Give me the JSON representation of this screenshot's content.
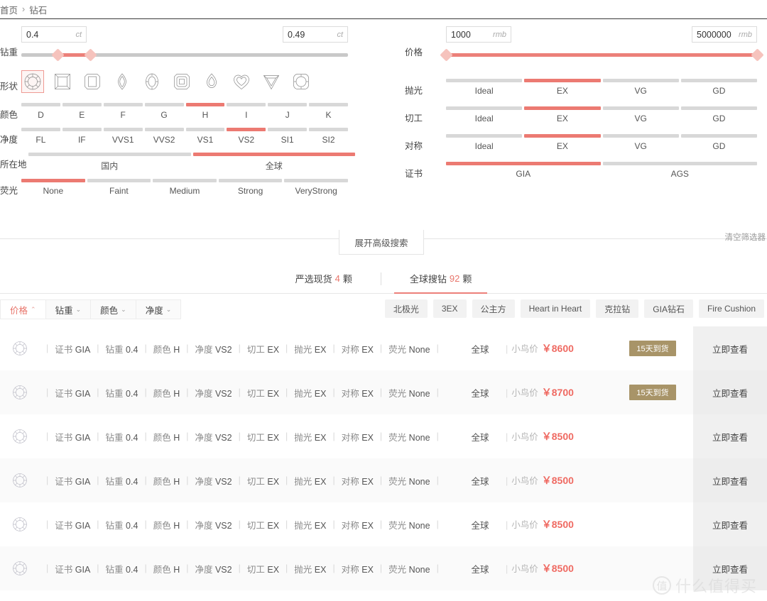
{
  "breadcrumb": {
    "home": "首页",
    "sep": "›",
    "current": "钻石"
  },
  "filters": {
    "carat": {
      "label": "钻重",
      "min_value": "0.4",
      "max_value": "0.49",
      "unit": "ct",
      "min_pct": 11,
      "max_pct": 21
    },
    "price": {
      "label": "价格",
      "min_value": "1000",
      "max_value": "5000000",
      "unit": "rmb",
      "min_pct": 0,
      "max_pct": 100
    },
    "shape": {
      "label": "形状",
      "items": [
        {
          "name": "round",
          "selected": true
        },
        {
          "name": "princess",
          "selected": false
        },
        {
          "name": "emerald",
          "selected": false
        },
        {
          "name": "marquise",
          "selected": false
        },
        {
          "name": "oval",
          "selected": false
        },
        {
          "name": "radiant",
          "selected": false
        },
        {
          "name": "pear",
          "selected": false
        },
        {
          "name": "heart",
          "selected": false
        },
        {
          "name": "trillion",
          "selected": false
        },
        {
          "name": "cushion",
          "selected": false
        }
      ]
    },
    "color": {
      "label": "颜色",
      "options": [
        "D",
        "E",
        "F",
        "G",
        "H",
        "I",
        "J",
        "K"
      ],
      "selected_index": 4
    },
    "clarity": {
      "label": "净度",
      "options": [
        "FL",
        "IF",
        "VVS1",
        "VVS2",
        "VS1",
        "VS2",
        "SI1",
        "SI2"
      ],
      "selected_index": 5
    },
    "location": {
      "label": "所在地",
      "options": [
        "国内",
        "全球"
      ],
      "selected_index": 1
    },
    "fluorescence": {
      "label": "荧光",
      "options": [
        "None",
        "Faint",
        "Medium",
        "Strong",
        "VeryStrong"
      ],
      "selected_index": 0
    },
    "polish": {
      "label": "抛光",
      "options": [
        "Ideal",
        "EX",
        "VG",
        "GD"
      ],
      "selected_index": 1
    },
    "cut": {
      "label": "切工",
      "options": [
        "Ideal",
        "EX",
        "VG",
        "GD"
      ],
      "selected_index": 1
    },
    "symmetry": {
      "label": "对称",
      "options": [
        "Ideal",
        "EX",
        "VG",
        "GD"
      ],
      "selected_index": 1
    },
    "cert": {
      "label": "证书",
      "options": [
        "GIA",
        "AGS"
      ],
      "selected_index": 0
    },
    "advanced_button": "展开高级搜索",
    "clear_link": "清空筛选器"
  },
  "tabs": [
    {
      "label_before": "严选现货",
      "count": "4",
      "label_after": "颗",
      "active": false
    },
    {
      "label_before": "全球搜钻",
      "count": "92",
      "label_after": "颗",
      "active": true
    }
  ],
  "sorts": [
    {
      "label": "价格",
      "caret": "⌃",
      "active": true
    },
    {
      "label": "钻重",
      "caret": "⌄",
      "active": false
    },
    {
      "label": "颜色",
      "caret": "⌄",
      "active": false
    },
    {
      "label": "净度",
      "caret": "⌄",
      "active": false
    }
  ],
  "tags": [
    "北极光",
    "3EX",
    "公主方",
    "Heart in Heart",
    "克拉钻",
    "GIA钻石",
    "Fire Cushion"
  ],
  "results": {
    "spec_keys": {
      "cert": "证书",
      "carat": "钻重",
      "color": "颜色",
      "clarity": "净度",
      "cut": "切工",
      "polish": "抛光",
      "symmetry": "对称",
      "fluorescence": "荧光"
    },
    "price_label": "小鸟价",
    "currency": "￥",
    "view_button": "立即查看",
    "rows": [
      {
        "cert": "GIA",
        "carat": "0.4",
        "color": "H",
        "clarity": "VS2",
        "cut": "EX",
        "polish": "EX",
        "symmetry": "EX",
        "fluorescence": "None",
        "origin": "全球",
        "price": "8600",
        "badge": "15天到货"
      },
      {
        "cert": "GIA",
        "carat": "0.4",
        "color": "H",
        "clarity": "VS2",
        "cut": "EX",
        "polish": "EX",
        "symmetry": "EX",
        "fluorescence": "None",
        "origin": "全球",
        "price": "8700",
        "badge": "15天到货"
      },
      {
        "cert": "GIA",
        "carat": "0.4",
        "color": "H",
        "clarity": "VS2",
        "cut": "EX",
        "polish": "EX",
        "symmetry": "EX",
        "fluorescence": "None",
        "origin": "全球",
        "price": "8500",
        "badge": ""
      },
      {
        "cert": "GIA",
        "carat": "0.4",
        "color": "H",
        "clarity": "VS2",
        "cut": "EX",
        "polish": "EX",
        "symmetry": "EX",
        "fluorescence": "None",
        "origin": "全球",
        "price": "8500",
        "badge": ""
      },
      {
        "cert": "GIA",
        "carat": "0.4",
        "color": "H",
        "clarity": "VS2",
        "cut": "EX",
        "polish": "EX",
        "symmetry": "EX",
        "fluorescence": "None",
        "origin": "全球",
        "price": "8500",
        "badge": ""
      },
      {
        "cert": "GIA",
        "carat": "0.4",
        "color": "H",
        "clarity": "VS2",
        "cut": "EX",
        "polish": "EX",
        "symmetry": "EX",
        "fluorescence": "None",
        "origin": "全球",
        "price": "8500",
        "badge": ""
      }
    ]
  },
  "watermark": {
    "logo": "值",
    "text": "什么值得买"
  },
  "colors": {
    "accent": "#ec7a72",
    "price": "#ef6a62",
    "badge": "#a89468"
  }
}
